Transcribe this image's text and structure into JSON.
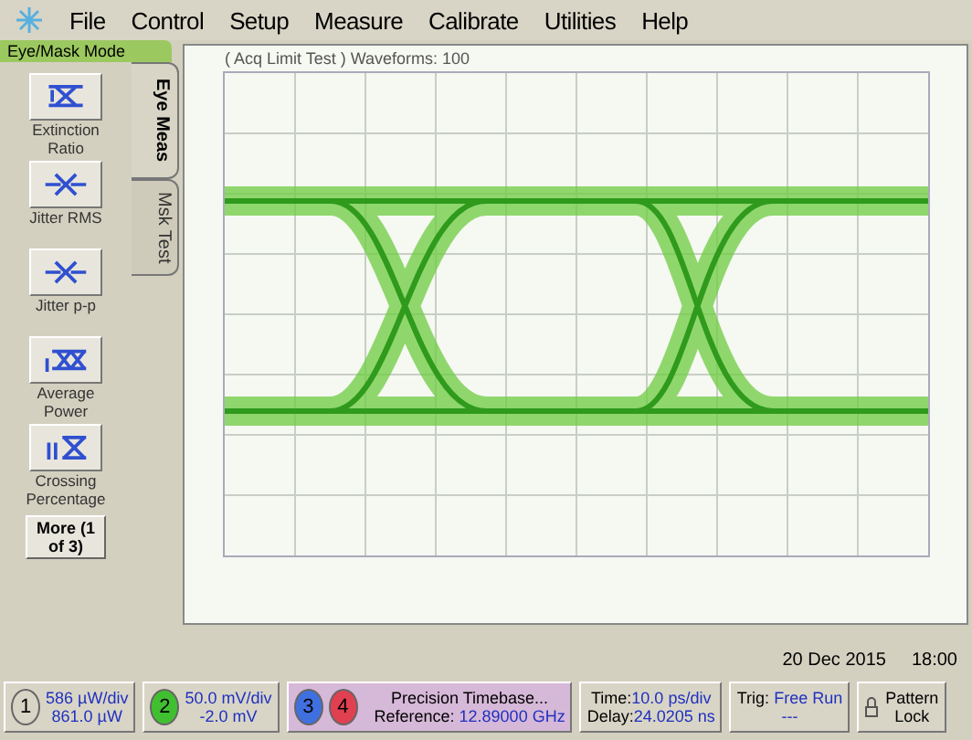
{
  "menu": [
    "File",
    "Control",
    "Setup",
    "Measure",
    "Calibrate",
    "Utilities",
    "Help"
  ],
  "mode_label": "Eye/Mask Mode",
  "measurements": [
    {
      "label": "Extinction Ratio",
      "kind": "extinction"
    },
    {
      "label": "Jitter RMS",
      "kind": "jitter"
    },
    {
      "label": "Jitter p-p",
      "kind": "jitter"
    },
    {
      "label": "Average Power",
      "kind": "power"
    },
    {
      "label": "Crossing Percentage",
      "kind": "crossing"
    }
  ],
  "more_button": "More (1 of 3)",
  "tabs": [
    {
      "label": "Eye Meas",
      "selected": true
    },
    {
      "label": "Msk Test",
      "selected": false
    }
  ],
  "display": {
    "status": "( Acq Limit Test )  Waveforms: 100"
  },
  "date": "20 Dec 2015",
  "time": "18:00",
  "status_bar": {
    "channel_1": {
      "number": "1",
      "scale": "586 µW/div",
      "offset": "861.0 µW"
    },
    "channel_2": {
      "number": "2",
      "scale": "50.0 mV/div",
      "offset": "-2.0 mV"
    },
    "channels_3_4": [
      "3",
      "4"
    ],
    "timebase": {
      "title": "Precision Timebase...",
      "reference_label": "Reference:",
      "reference": "12.89000 GHz"
    },
    "time": {
      "time_label": "Time:",
      "time": "10.0 ps/div",
      "delay_label": "Delay:",
      "delay": "24.0205 ns"
    },
    "trigger": {
      "label": "Trig:",
      "value": "Free Run",
      "sub": "---"
    },
    "pattern_lock": "Pattern Lock"
  }
}
